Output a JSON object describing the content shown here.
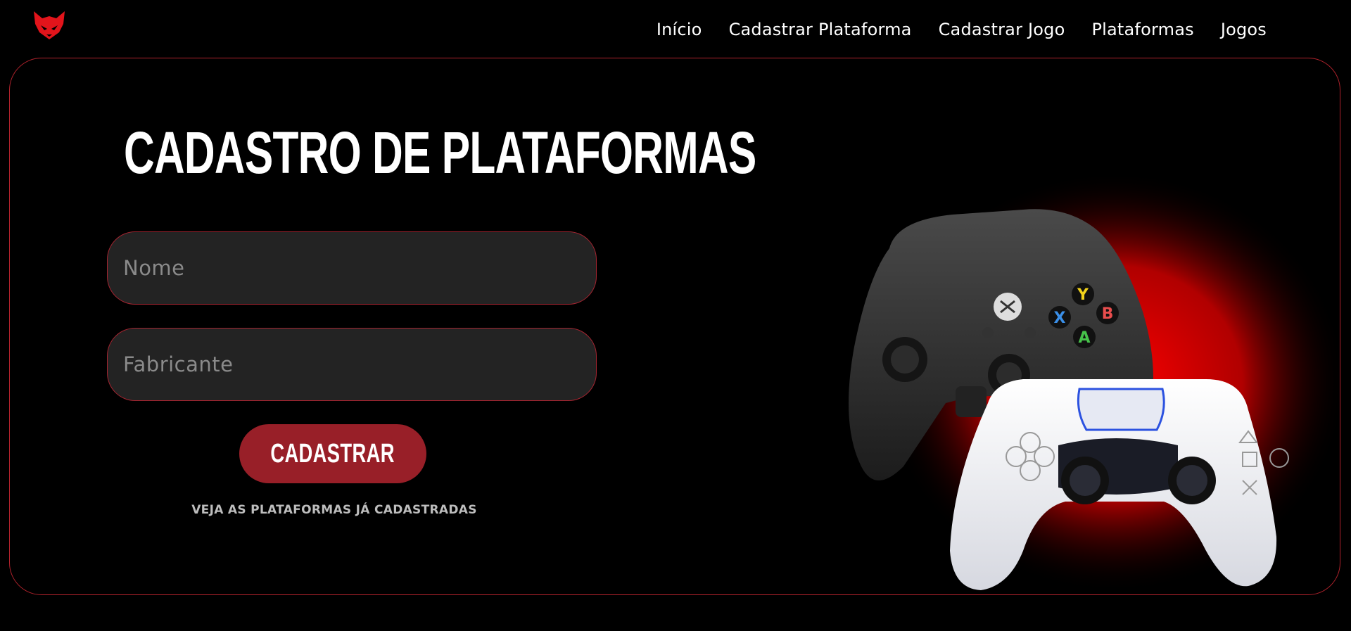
{
  "header": {
    "logo_icon": "fox-head-logo-icon",
    "nav": [
      {
        "label": "Início"
      },
      {
        "label": "Cadastrar Plataforma"
      },
      {
        "label": "Cadastrar Jogo"
      },
      {
        "label": "Plataformas"
      },
      {
        "label": "Jogos"
      }
    ]
  },
  "form": {
    "title": "CADASTRO DE PLATAFORMAS",
    "name_field": {
      "placeholder": "Nome",
      "value": ""
    },
    "maker_field": {
      "placeholder": "Fabricante",
      "value": ""
    },
    "submit_label": "CADASTRAR",
    "view_link": "VEJA AS PLATAFORMAS JÁ CADASTRADAS"
  },
  "illustration": {
    "controllers": [
      "xbox-controller-icon",
      "playstation-controller-icon"
    ],
    "xbox_buttons": [
      "Y",
      "B",
      "X",
      "A"
    ]
  },
  "colors": {
    "background": "#000000",
    "accent": "#b0222c",
    "button": "#981f28",
    "field": "#232323"
  }
}
